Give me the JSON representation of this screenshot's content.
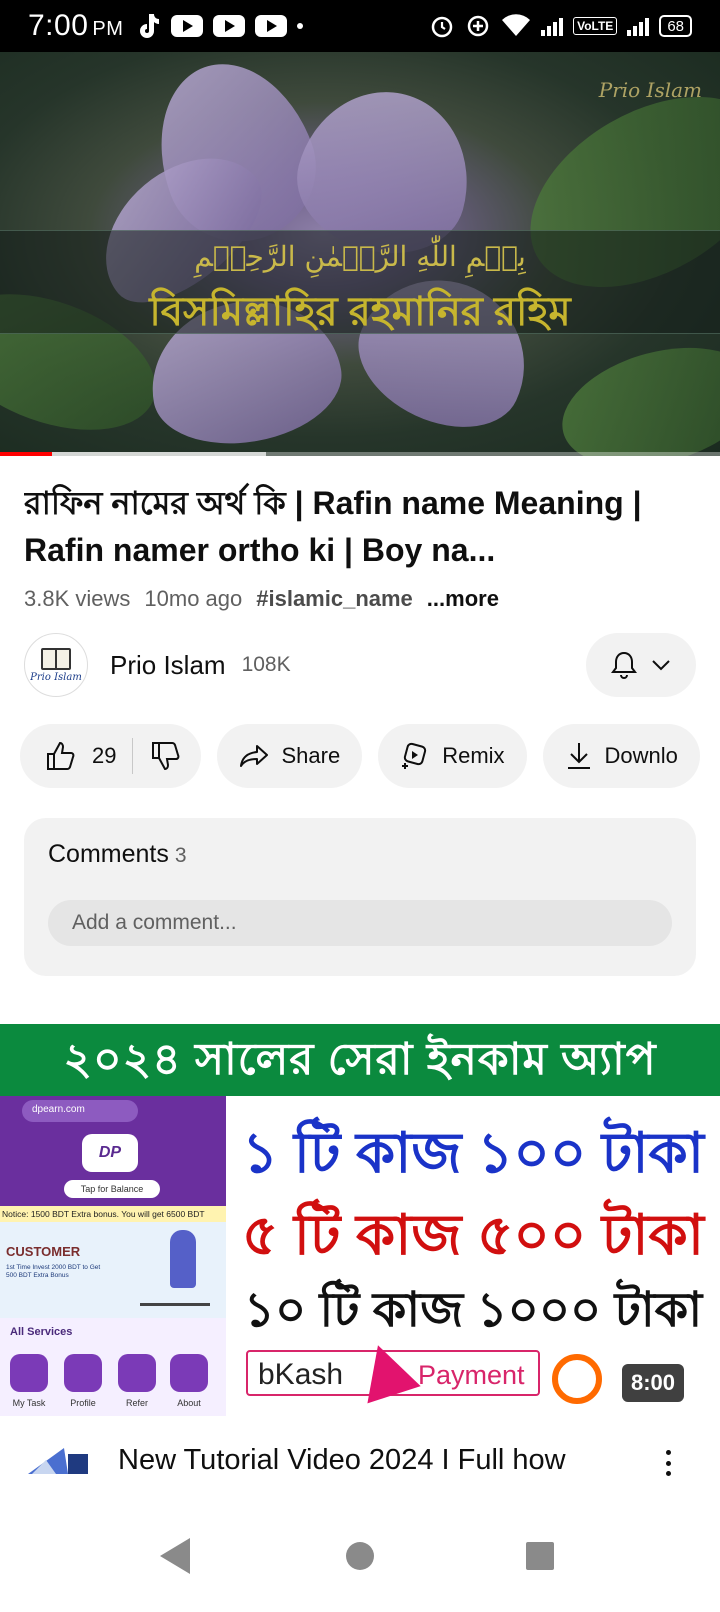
{
  "status_bar": {
    "time": "7:00",
    "ampm": "PM",
    "volte": "VoLTE",
    "battery": "68"
  },
  "player": {
    "watermark": "Prio Islam",
    "arabic_caption": "بِسۡمِ اللّٰهِ الرَّحۡمٰنِ الرَّحِیۡمِ",
    "bangla_caption": "বিসমিল্লাহির রহমানির রহিম",
    "progress_played": 0.072,
    "progress_buffered": 0.37
  },
  "video": {
    "title": "রাফিন নামের অর্থ কি | Rafin name Meaning | Rafin namer ortho ki | Boy na...",
    "views": "3.8K views",
    "age": "10mo ago",
    "hashtag": "#islamic_name",
    "more": "...more"
  },
  "channel": {
    "name": "Prio Islam",
    "subscribers": "108K",
    "avatar_text": "Prio Islam"
  },
  "actions": {
    "like_count": "29",
    "share": "Share",
    "remix": "Remix",
    "download": "Downlo"
  },
  "comments": {
    "title": "Comments",
    "count": "3",
    "placeholder": "Add a comment..."
  },
  "next_video": {
    "banner": "২০২৪ সালের সেরা ইনকাম অ্যাপ",
    "url": "dpearn.com",
    "logo": "DP",
    "tap_balance": "Tap for Balance",
    "notice": "Notice: 1500 BDT Extra bonus. You will get 6500 BDT",
    "customer": "CUSTOMER",
    "customer_sub": "1st Time Invest 2000 BDT to Get 500 BDT Extra Bonus",
    "all_services": "All Services",
    "services": [
      "My Task",
      "Profile",
      "Refer",
      "About"
    ],
    "offer_1": "১ টি কাজ ১০০ টাকা",
    "offer_2": "৫ টি কাজ ৫০০ টাকা",
    "offer_3": "১০ টি কাজ ১০০০ টাকা",
    "bkash": "bKash",
    "payment": "Payment",
    "duration": "8:00",
    "title": "New Tutorial Video 2024 I Full how"
  },
  "colors": {
    "progress_red": "#ff0000",
    "banner_green": "#0b8a3e",
    "offer_blue": "#1a33c8",
    "offer_red": "#d10f0f",
    "bkash_pink": "#e2136e"
  }
}
